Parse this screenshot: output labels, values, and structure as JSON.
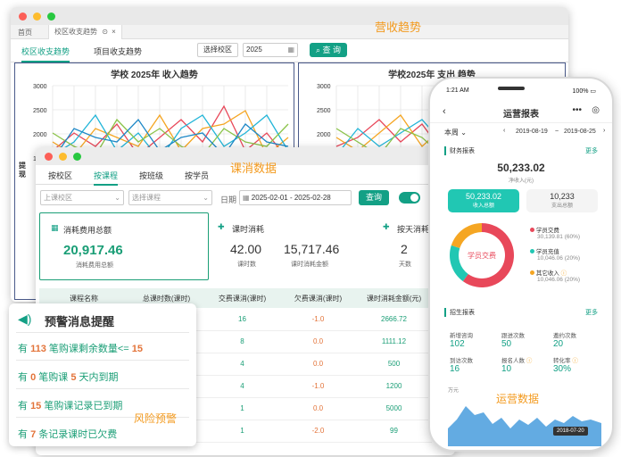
{
  "captions": {
    "revenue": "营收趋势",
    "course": "课消数据",
    "ops": "运营数据",
    "risk": "风险预警"
  },
  "revenue_window": {
    "tabs": [
      "首页",
      "校区收支趋势"
    ],
    "subtabs": [
      "校区收支趋势",
      "项目收支趋势"
    ],
    "campus_select": "选择校区",
    "year_value": "2025",
    "query_label": "查 询",
    "income_title": "学校 2025年 收入趋势",
    "expense_title": "学校2025年 支出 趋势",
    "y_ticks": [
      "3000",
      "2500",
      "2000",
      "1500"
    ],
    "side_text": "提现"
  },
  "course_window": {
    "tabs": [
      "按校区",
      "按课程",
      "按班级",
      "按学员"
    ],
    "campus_placeholder": "上课校区",
    "course_placeholder": "选择课程",
    "date_label": "日期",
    "date_range": "2025-02-01 - 2025-02-28",
    "query_label": "查询",
    "card1": {
      "title": "消耗费用总额",
      "value": "20,917.46",
      "sub": "消耗费用总额"
    },
    "card2": {
      "title": "课时消耗",
      "v1": "42.00",
      "s1": "课时数",
      "v2": "15,717.46",
      "s2": "课时消耗金额"
    },
    "card3": {
      "title": "按天消耗",
      "v1": "2",
      "s1": "天数"
    },
    "table_headers": [
      "课程名称",
      "总课时数(课时)",
      "交费课消(课时)",
      "欠费课消(课时)",
      "课时消耗金额(元)"
    ],
    "rows": [
      [
        "16",
        "-1.0",
        "2666.72"
      ],
      [
        "8",
        "0.0",
        "1111.12"
      ],
      [
        "4",
        "0.0",
        "500"
      ],
      [
        "4",
        "-1.0",
        "1200"
      ],
      [
        "1",
        "0.0",
        "5000"
      ],
      [
        "1",
        "-2.0",
        "99"
      ]
    ]
  },
  "warning": {
    "title": "预警消息提醒",
    "rows": [
      {
        "pre": "有",
        "n1": "113",
        "mid": "笔购课剩余数量<=",
        "n2": "15",
        "post": ""
      },
      {
        "pre": "有",
        "n1": "0",
        "mid": "笔购课",
        "n2": "5",
        "post": "天内到期"
      },
      {
        "pre": "有",
        "n1": "15",
        "mid": "笔购课记录已到期",
        "n2": "",
        "post": ""
      },
      {
        "pre": "有",
        "n1": "7",
        "mid": "条记录课时已欠费",
        "n2": "",
        "post": ""
      }
    ]
  },
  "phone": {
    "time": "1:21 AM",
    "battery": "100%",
    "title": "运营报表",
    "period": "本周",
    "date_start": "2019-08-19",
    "date_end": "2019-08-25",
    "finance_label": "财务报表",
    "more": "更多",
    "total_value": "50,233.02",
    "total_sub": "净收入(元)",
    "income_value": "50,233.02",
    "income_label": "收入总额",
    "expense_value": "10,233",
    "expense_label": "支出总额",
    "donut_center": "学员交费",
    "legend": [
      {
        "name": "学员交费",
        "value": "30,139.81 (60%)",
        "color": "#e8485a"
      },
      {
        "name": "学员充值",
        "value": "10,046.06 (20%)",
        "color": "#21c7b3"
      },
      {
        "name": "其它收入",
        "value": "10,046.06 (20%)",
        "color": "#f5a623"
      }
    ],
    "donut_fractions": [
      0.6,
      0.2,
      0.2
    ],
    "enroll_label": "招生报表",
    "stats": [
      {
        "label": "新增咨询",
        "value": "102"
      },
      {
        "label": "跟进次数",
        "value": "50"
      },
      {
        "label": "邀约次数",
        "value": "20"
      },
      {
        "label": "到访次数",
        "value": "16"
      },
      {
        "label": "报名人数",
        "value": "10"
      },
      {
        "label": "转化率",
        "value": "30%"
      }
    ],
    "chart_unit": "万元",
    "chart_date": "2018-07-20"
  },
  "colors": {
    "accent": "#13a085",
    "orange": "#f39a1e",
    "value_orange": "#e3743a"
  }
}
